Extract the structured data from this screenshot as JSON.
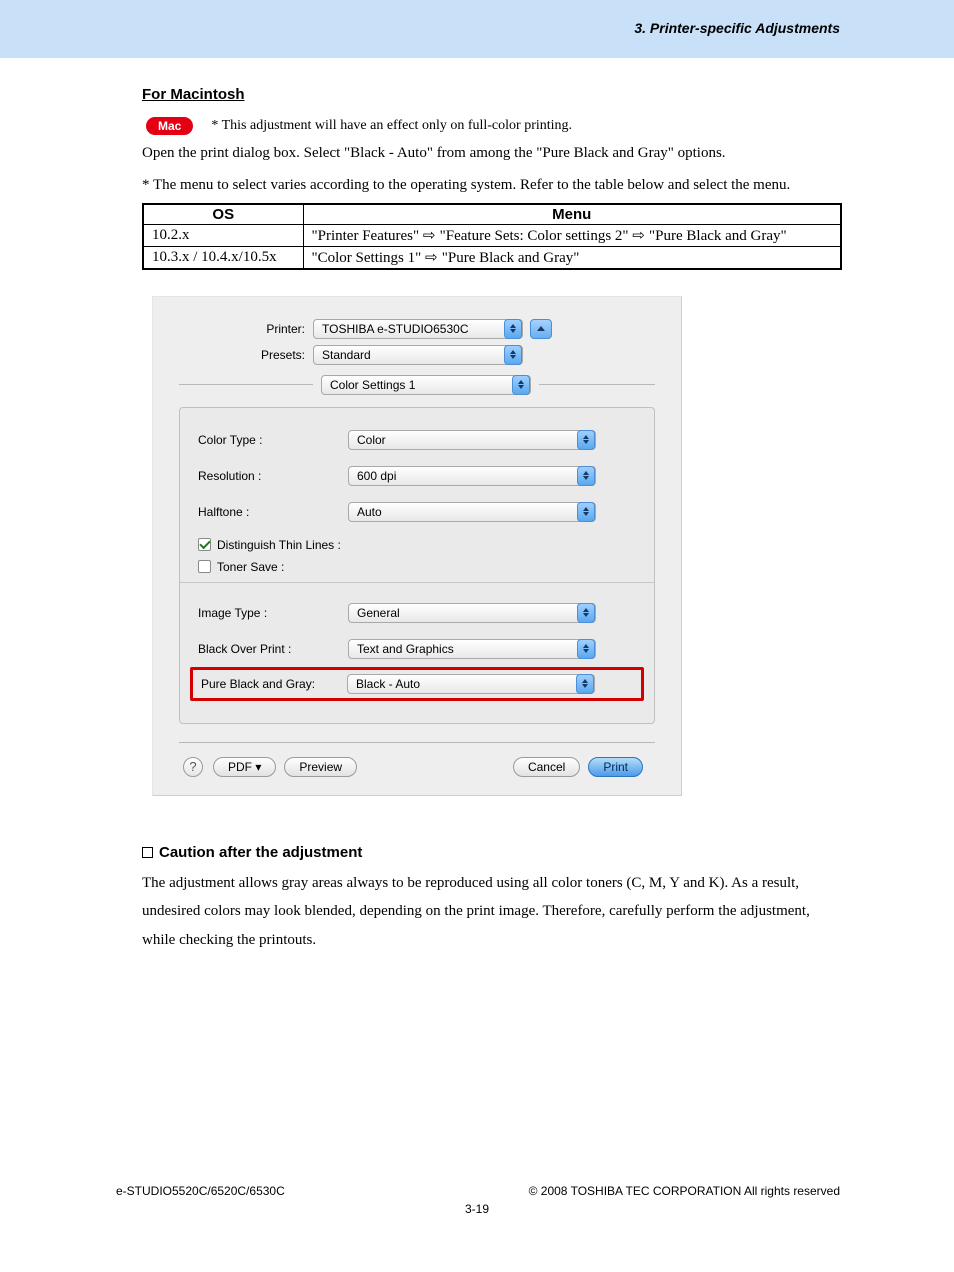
{
  "header": {
    "section": "3. Printer-specific Adjustments"
  },
  "section_title": "For Macintosh",
  "mac_badge": "Mac",
  "mac_note": "* This adjustment will have an effect only on full-color printing.",
  "body1": "Open the print dialog box.  Select \"Black - Auto\" from among the \"Pure Black and Gray\" options.",
  "body2": "* The menu to select varies according to the operating system.  Refer to the table below and select the menu.",
  "table": {
    "headers": [
      "OS",
      "Menu"
    ],
    "rows": [
      {
        "os": "10.2.x",
        "menu_parts": [
          "\"Printer Features\"",
          "\"Feature Sets: Color settings 2\"",
          "\"Pure Black and Gray\""
        ]
      },
      {
        "os": "10.3.x / 10.4.x/10.5x",
        "menu_parts": [
          "\"Color Settings 1\"",
          "\"Pure Black and Gray\""
        ]
      }
    ]
  },
  "dialog": {
    "printer_label": "Printer:",
    "printer_value": "TOSHIBA e-STUDIO6530C",
    "presets_label": "Presets:",
    "presets_value": "Standard",
    "section_select": "Color Settings 1",
    "panel": {
      "color_type_label": "Color Type :",
      "color_type_value": "Color",
      "resolution_label": "Resolution :",
      "resolution_value": "600 dpi",
      "halftone_label": "Halftone :",
      "halftone_value": "Auto",
      "distinguish_label": "Distinguish Thin Lines :",
      "toner_save_label": "Toner Save :",
      "image_type_label": "Image Type :",
      "image_type_value": "General",
      "black_over_label": "Black Over Print :",
      "black_over_value": "Text and Graphics",
      "pure_black_label": "Pure Black and Gray:",
      "pure_black_value": "Black - Auto"
    },
    "footer": {
      "pdf": "PDF ▾",
      "preview": "Preview",
      "cancel": "Cancel",
      "print": "Print"
    }
  },
  "caution": {
    "heading": "Caution after the adjustment",
    "text": "The adjustment allows gray areas always to be reproduced using all color toners (C, M, Y and K).  As a result, undesired colors may look blended, depending on the print image.  Therefore, carefully perform the adjustment, while checking the printouts."
  },
  "footer": {
    "left": "e-STUDIO5520C/6520C/6530C",
    "right": "© 2008 TOSHIBA TEC CORPORATION All rights reserved",
    "page": "3-19"
  }
}
